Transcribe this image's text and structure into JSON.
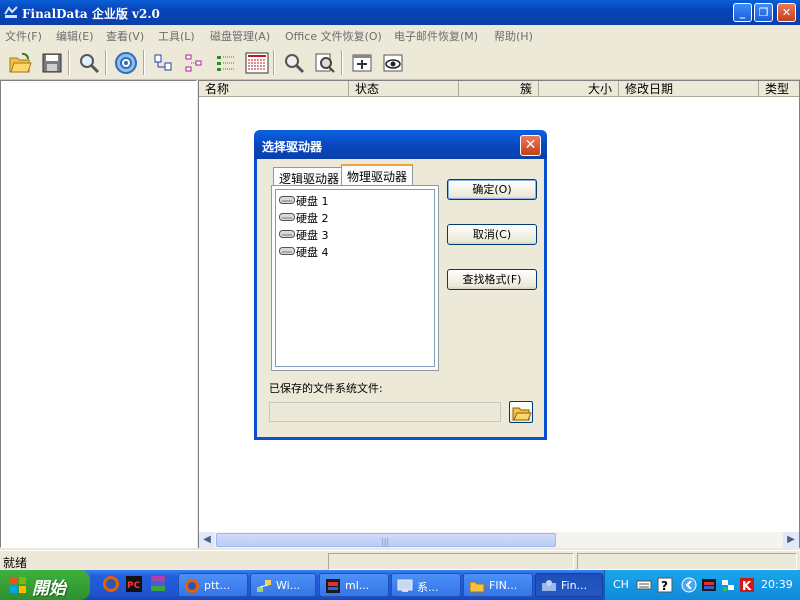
{
  "window": {
    "title": "FinalData 企业版 v2.0",
    "buttons": {
      "minimize": "_",
      "maximize": "❐",
      "close": "✕"
    }
  },
  "menu": [
    "文件(F)",
    "编辑(E)",
    "查看(V)",
    "工具(L)",
    "磁盘管理(A)",
    "Office 文件恢复(O)",
    "电子邮件恢复(M)",
    "帮助(H)"
  ],
  "list": {
    "columns": [
      "名称",
      "状态",
      "簇",
      "大小",
      "修改日期",
      "类型"
    ]
  },
  "status": {
    "text": "就绪"
  },
  "dialog": {
    "title": "选择驱动器",
    "tabs": [
      "逻辑驱动器",
      "物理驱动器"
    ],
    "selected_tab": "物理驱动器",
    "drives": [
      "硬盘 1",
      "硬盘 2",
      "硬盘 3",
      "硬盘 4"
    ],
    "ok": "确定(O)",
    "cancel": "取消(C)",
    "find_format": "查找格式(F)",
    "saved_label": "已保存的文件系统文件:",
    "saved_value": ""
  },
  "taskbar": {
    "start": "開始",
    "tasks": [
      "ptt...",
      "Wi...",
      "ml...",
      "系...",
      "FIN...",
      "Fin..."
    ],
    "active_task": "Fin...",
    "ime": "CH",
    "clock": "20:39"
  },
  "colors": {
    "titlebar": "#0844b8",
    "window_bg": "#ece9d8",
    "taskbar": "#245edb",
    "start": "#2f8f2f",
    "tray": "#0f8ad8",
    "close_button": "#c44019"
  }
}
